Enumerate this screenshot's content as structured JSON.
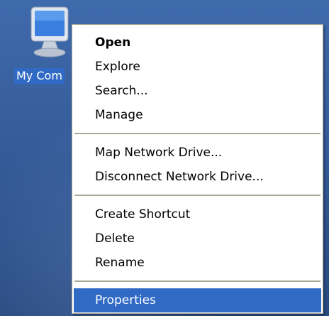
{
  "desktop": {
    "icon": {
      "name": "my-computer-icon",
      "label": "My Com"
    }
  },
  "context_menu": {
    "groups": [
      [
        {
          "label": "Open",
          "bold": true
        },
        {
          "label": "Explore"
        },
        {
          "label": "Search..."
        },
        {
          "label": "Manage"
        }
      ],
      [
        {
          "label": "Map Network Drive..."
        },
        {
          "label": "Disconnect Network Drive..."
        }
      ],
      [
        {
          "label": "Create Shortcut"
        },
        {
          "label": "Delete"
        },
        {
          "label": "Rename"
        }
      ],
      [
        {
          "label": "Properties",
          "selected": true
        }
      ]
    ]
  },
  "colors": {
    "desktop_blue": "#375e9c",
    "selection_blue": "#316ac5",
    "menu_border": "#aca899"
  }
}
